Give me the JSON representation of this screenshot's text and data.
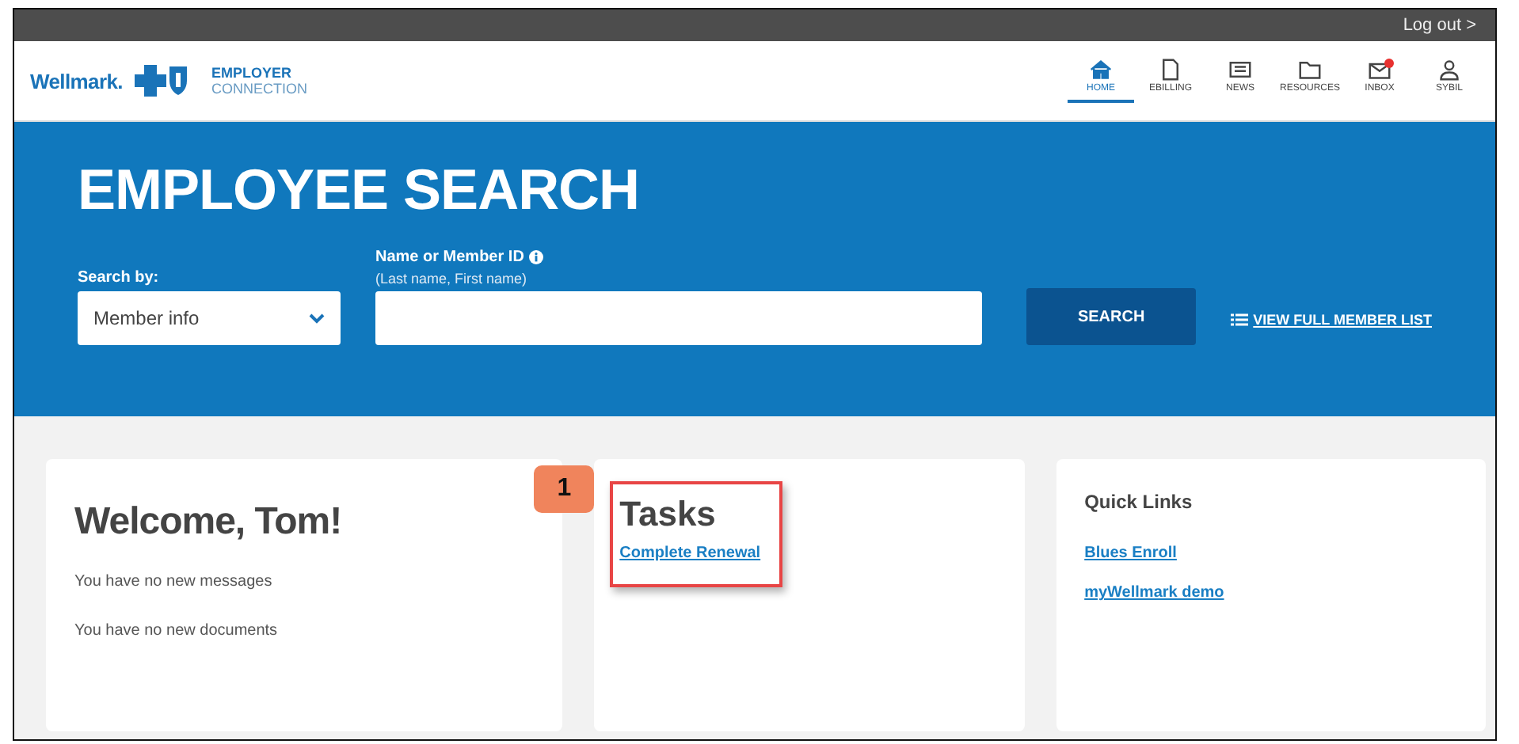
{
  "top_bar": {
    "logout": "Log out >"
  },
  "header": {
    "logo": {
      "brand": "Wellmark.",
      "product_line_1": "EMPLOYER",
      "product_line_2": "CONNECTION"
    },
    "nav": [
      {
        "label": "HOME",
        "kind": "home",
        "selected": true,
        "notification": false
      },
      {
        "label": "EBILLING",
        "kind": "bill",
        "selected": false,
        "notification": false
      },
      {
        "label": "NEWS",
        "kind": "news",
        "selected": false,
        "notification": false
      },
      {
        "label": "RESOURCES",
        "kind": "folder",
        "selected": false,
        "notification": false
      },
      {
        "label": "INBOX",
        "kind": "mail",
        "selected": false,
        "notification": true
      },
      {
        "label": "SYBIL",
        "kind": "user",
        "selected": false,
        "notification": false
      }
    ]
  },
  "search": {
    "title": "EMPLOYEE SEARCH",
    "search_by_label": "Search by:",
    "search_by_value": "Member info",
    "name_label": "Name or Member ID",
    "name_hint": "(Last name, First name)",
    "button": "SEARCH",
    "full_list_link": "VIEW FULL MEMBER LIST"
  },
  "cards": [
    {
      "kind": "welcome",
      "title": "Welcome, Tom!",
      "lines": [
        "You have no new messages",
        "You have no new documents"
      ]
    },
    {
      "kind": "tasks",
      "title": "Tasks",
      "links": [
        "Complete Renewal"
      ],
      "callout": "1",
      "highlighted": true
    },
    {
      "kind": "links",
      "title": "Quick Links",
      "links": [
        "Blues Enroll",
        "myWellmark demo"
      ]
    }
  ]
}
